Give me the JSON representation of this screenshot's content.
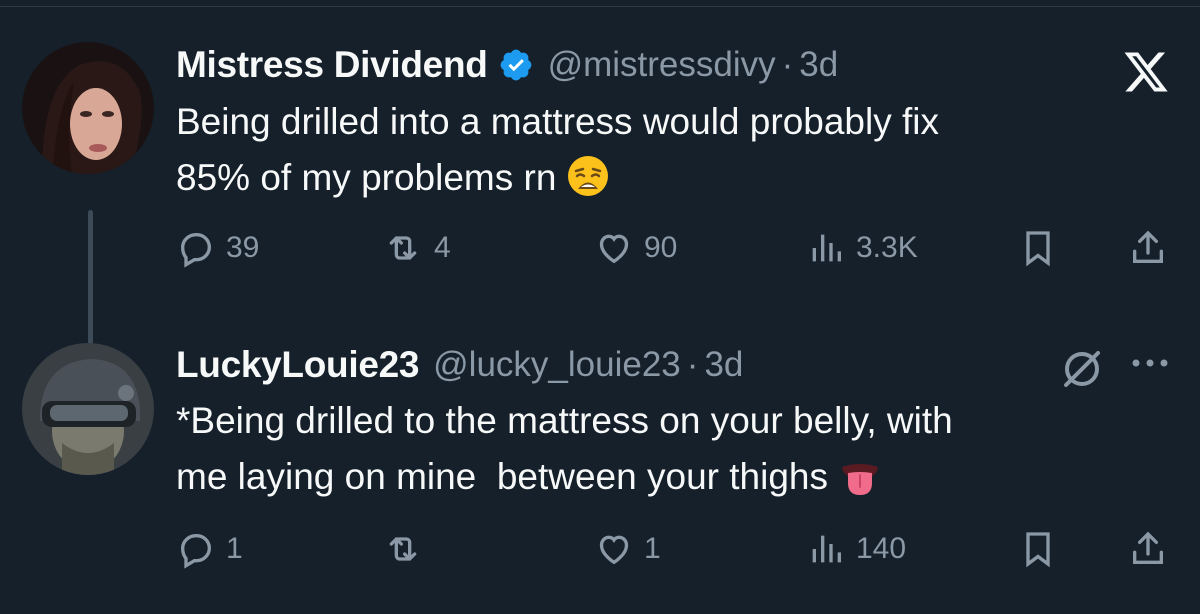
{
  "tweets": [
    {
      "author_name": "Mistress Dividend",
      "handle": "@mistressdivy",
      "separator": "·",
      "time": "3d",
      "text_line1": "Being drilled into a mattress would probably fix",
      "text_line2": "85% of my problems rn",
      "emoji": "weary-face",
      "verified": true,
      "replies": "39",
      "reposts": "4",
      "likes": "90",
      "views": "3.3K"
    },
    {
      "author_name": "LuckyLouie23",
      "handle": "@lucky_louie23",
      "separator": "·",
      "time": "3d",
      "text_line1": "*Being drilled to the mattress on your belly, with",
      "text_line2": "me laying on mine  between your thighs",
      "emoji": "tongue",
      "verified": false,
      "replies": "1",
      "reposts": "",
      "likes": "1",
      "views": "140"
    }
  ],
  "colors": {
    "background": "#15202b",
    "text_primary": "#f7f9f9",
    "text_secondary": "#8b98a5",
    "verified_blue": "#1d9bf0"
  },
  "icons": [
    "x-logo-icon",
    "verified-badge-icon",
    "reply-icon",
    "repost-icon",
    "like-icon",
    "views-icon",
    "bookmark-icon",
    "share-icon",
    "grok-icon",
    "more-icon"
  ]
}
